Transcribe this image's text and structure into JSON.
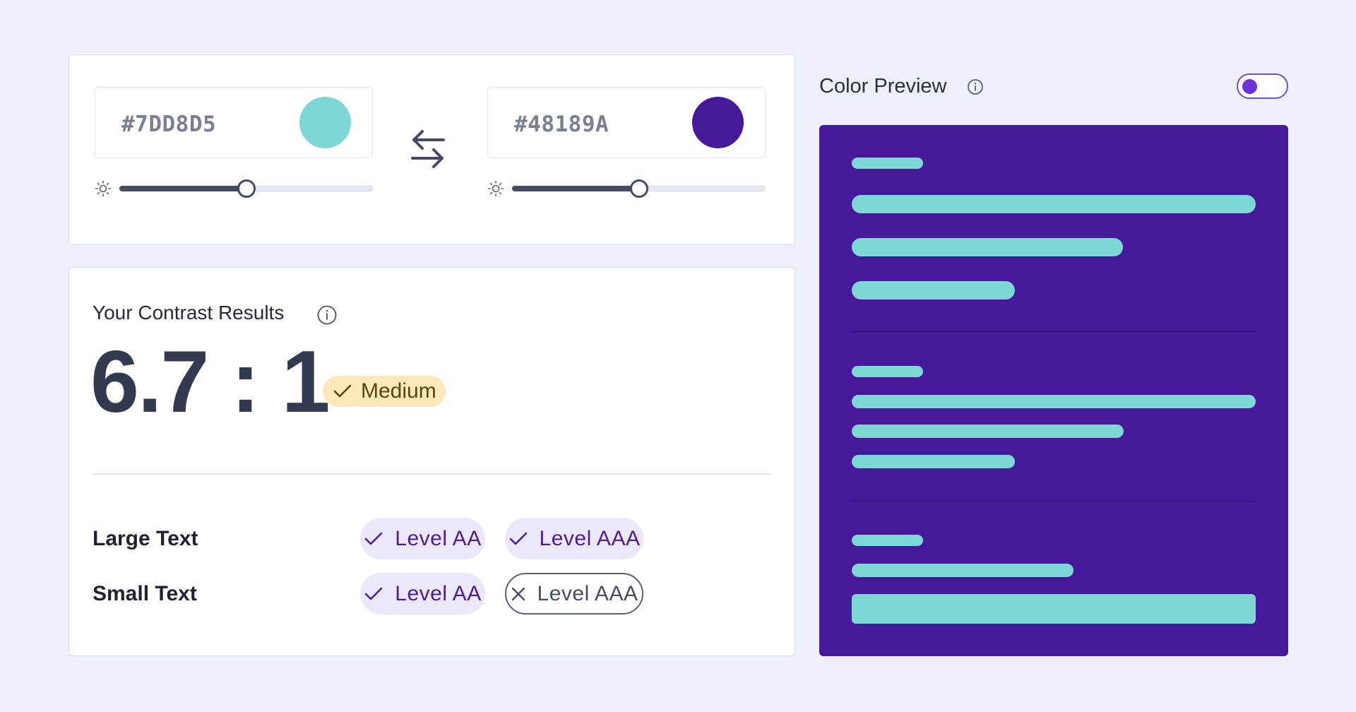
{
  "colors": {
    "foreground": "#7DD8D5",
    "background": "#48189A",
    "accent": "#6a32d8",
    "rating_badge": "#fde9b9",
    "pass_pill": "#ece8fb"
  },
  "picker": {
    "foreground_hex": "#7DD8D5",
    "background_hex": "#48189A",
    "foreground_brightness": 0.5,
    "background_brightness": 0.5,
    "brightness_icon": "sun-icon",
    "swap_icon": "swap-arrows-icon"
  },
  "results": {
    "title": "Your Contrast Results",
    "ratio": "6.7 : 1",
    "rating": "Medium",
    "rows": [
      {
        "label": "Large Text",
        "checks": [
          {
            "label": "Level AA",
            "pass": true
          },
          {
            "label": "Level AAA",
            "pass": true
          }
        ]
      },
      {
        "label": "Small Text",
        "checks": [
          {
            "label": "Level AA",
            "pass": true
          },
          {
            "label": "Level AAA",
            "pass": false
          }
        ]
      }
    ]
  },
  "preview": {
    "title": "Color Preview",
    "toggle_on": true
  }
}
